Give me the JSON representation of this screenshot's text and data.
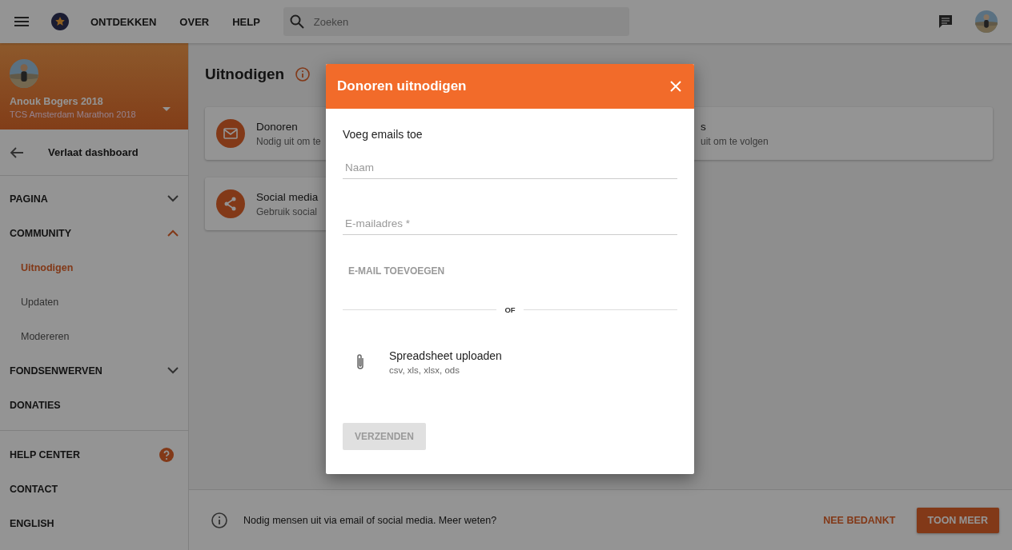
{
  "topbar": {
    "nav": [
      "ONTDEKKEN",
      "OVER",
      "HELP"
    ],
    "search": {
      "placeholder": "Zoeken"
    }
  },
  "sidebar": {
    "profile": {
      "name": "Anouk Bogers 2018",
      "event": "TCS Amsterdam Marathon 2018"
    },
    "back": "Verlaat dashboard",
    "sections": [
      {
        "kind": "group",
        "label": "PAGINA",
        "expanded": false
      },
      {
        "kind": "group",
        "label": "COMMUNITY",
        "expanded": true,
        "children": [
          {
            "label": "Uitnodigen",
            "selected": true
          },
          {
            "label": "Updaten",
            "selected": false
          },
          {
            "label": "Modereren",
            "selected": false
          }
        ]
      },
      {
        "kind": "group",
        "label": "FONDSENWERVEN",
        "expanded": false
      },
      {
        "kind": "link",
        "label": "DONATIES"
      }
    ],
    "footer_links": [
      {
        "label": "HELP CENTER",
        "kind": "help"
      },
      {
        "label": "CONTACT",
        "kind": "plain"
      },
      {
        "label": "ENGLISH",
        "kind": "plain"
      }
    ]
  },
  "main": {
    "title": "Uitnodigen",
    "cards": [
      {
        "kind": "mail",
        "title": "Donoren",
        "text": "Nodig uit om te"
      },
      {
        "kind": "plain",
        "title": "s",
        "text": "uit om te volgen"
      },
      {
        "kind": "share",
        "title": "Social media",
        "text": "Gebruik social"
      }
    ]
  },
  "banner": {
    "text": "Nodig mensen uit via email of social media. Meer weten?",
    "dismiss": "NEE BEDANKT",
    "more": "TOON MEER"
  },
  "dialog": {
    "title": "Donoren uitnodigen",
    "heading": "Voeg emails toe",
    "fields": [
      {
        "placeholder": "Naam"
      },
      {
        "placeholder": "E-mailadres *"
      }
    ],
    "add": "E-MAIL TOEVOEGEN",
    "divider": "OF",
    "upload": {
      "title": "Spreadsheet uploaden",
      "formats": "csv, xls, xlsx, ods"
    },
    "submit": {
      "label": "VERZENDEN",
      "disabled": true
    }
  }
}
